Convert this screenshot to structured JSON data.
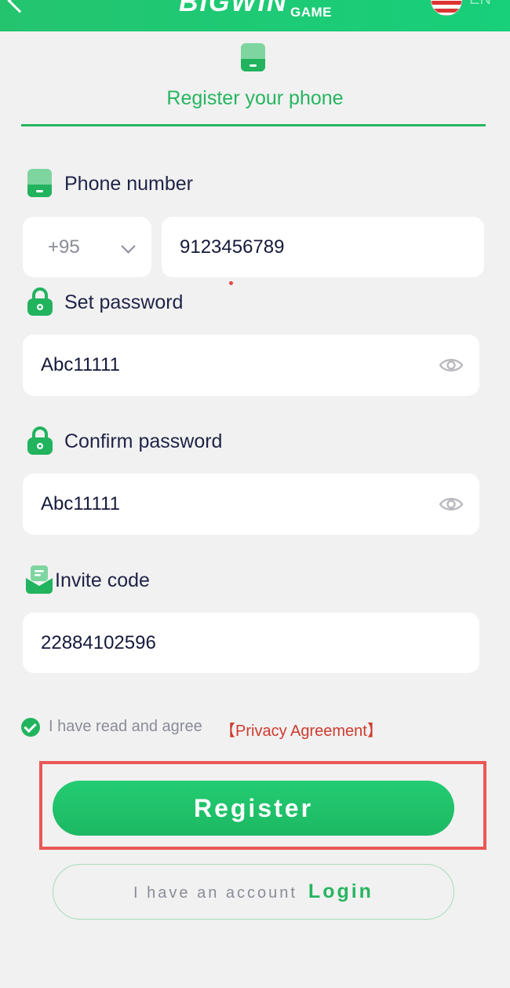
{
  "header": {
    "logo_text": "BIGWIN",
    "logo_sub": "GAME",
    "language": "EN",
    "back_icon": "chevron-left-icon",
    "flag_icon": "us-flag-icon"
  },
  "tab": {
    "title": "Register your phone",
    "icon": "phone-icon",
    "accent_color": "#27b560"
  },
  "form": {
    "phone_label": "Phone number",
    "country_code": "+95",
    "phone_value": "9123456789",
    "set_password_label": "Set password",
    "password_value": "Abc11111",
    "confirm_password_label": "Confirm password",
    "confirm_password_value": "Abc11111",
    "invite_label": "Invite code",
    "invite_value": "22884102596"
  },
  "agreement": {
    "text": "I have read and agree",
    "link": "【Privacy Agreement】",
    "checked": true
  },
  "actions": {
    "register": "Register",
    "have_account": "I have an account",
    "login": "Login"
  },
  "colors": {
    "primary": "#22b35e",
    "link_red": "#cf3b2f",
    "highlight": "#ea5757"
  }
}
